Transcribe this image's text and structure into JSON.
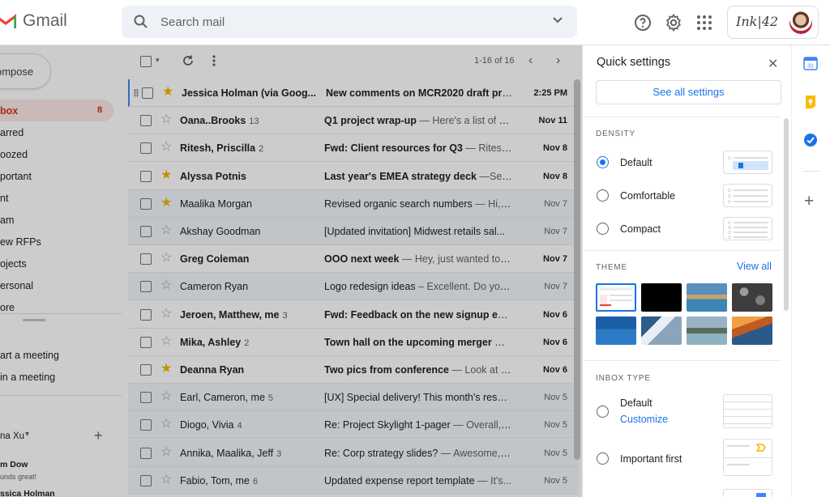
{
  "app": {
    "name": "Gmail"
  },
  "search": {
    "placeholder": "Search mail"
  },
  "account": {
    "brand": "Ink|42"
  },
  "sidebar": {
    "compose": "ompose",
    "items": [
      {
        "label": "box",
        "count": "8",
        "active": true
      },
      {
        "label": "arred"
      },
      {
        "label": "oozed"
      },
      {
        "label": "portant"
      },
      {
        "label": "nt"
      },
      {
        "label": "am"
      },
      {
        "label": "ew RFPs"
      },
      {
        "label": "ojects"
      },
      {
        "label": "ersonal"
      },
      {
        "label": "ore"
      }
    ],
    "meet": [
      "art a meeting",
      "in a meeting"
    ],
    "hangouts_user": "na Xu",
    "chats": [
      {
        "name": "m Dow",
        "sub": "unds great!"
      },
      {
        "name": "ssica Holman"
      }
    ]
  },
  "toolbar": {
    "pagination": "1-16 of 16"
  },
  "emails": [
    {
      "sender": "Jessica Holman (via Goog...",
      "count": "",
      "subject": "New comments on MCR2020 draft pres...",
      "snippet": "",
      "date": "2:25 PM",
      "starred": true,
      "unread": true
    },
    {
      "sender": "Oana..Brooks",
      "count": "13",
      "subject": "Q1 project wrap-up",
      "snippet": " — Here's a list of all...",
      "date": "Nov 11",
      "starred": false,
      "unread": true
    },
    {
      "sender": "Ritesh, Priscilla",
      "count": "2",
      "subject": "Fwd: Client resources for Q3",
      "snippet": " — Ritesh,...",
      "date": "Nov 8",
      "starred": false,
      "unread": true
    },
    {
      "sender": "Alyssa Potnis",
      "count": "",
      "subject": "Last year's EMEA strategy deck",
      "snippet": " —Sendi...",
      "date": "Nov 8",
      "starred": true,
      "unread": true
    },
    {
      "sender": "Maalika Morgan",
      "count": "",
      "subject": "Revised organic search numbers",
      "snippet": " — Hi, a ...",
      "date": "Nov 7",
      "starred": true,
      "unread": false
    },
    {
      "sender": "Akshay Goodman",
      "count": "",
      "subject": "[Updated invitation] Midwest retails sal...",
      "snippet": "",
      "date": "Nov 7",
      "starred": false,
      "unread": false
    },
    {
      "sender": "Greg Coleman",
      "count": "",
      "subject": "OOO next week",
      "snippet": " — Hey, just wanted to g...",
      "date": "Nov 7",
      "starred": false,
      "unread": true
    },
    {
      "sender": "Cameron Ryan",
      "count": "",
      "subject": "Logo redesign ideas",
      "snippet": " – Excellent. Do you...",
      "date": "Nov 7",
      "starred": false,
      "unread": false
    },
    {
      "sender": "Jeroen, Matthew, me",
      "count": "3",
      "subject": "Fwd: Feedback on the new signup expe...",
      "snippet": "",
      "date": "Nov 6",
      "starred": false,
      "unread": true
    },
    {
      "sender": "Mika, Ashley",
      "count": "2",
      "subject": "Town hall on the upcoming merger",
      "snippet": " — Ev...",
      "date": "Nov 6",
      "starred": false,
      "unread": true
    },
    {
      "sender": "Deanna Ryan",
      "count": "",
      "subject": "Two pics from conference",
      "snippet": " — Look at the...",
      "date": "Nov 6",
      "starred": true,
      "unread": true
    },
    {
      "sender": "Earl, Cameron, me",
      "count": "5",
      "subject": "[UX] Special delivery! This month's resea...",
      "snippet": "",
      "date": "Nov 5",
      "starred": false,
      "unread": false
    },
    {
      "sender": "Diogo, Vivia",
      "count": "4",
      "subject": "Re: Project Skylight 1-pager",
      "snippet": " — Overall, it...",
      "date": "Nov 5",
      "starred": false,
      "unread": false
    },
    {
      "sender": "Annika, Maalika, Jeff",
      "count": "3",
      "subject": "Re: Corp strategy slides?",
      "snippet": " — Awesome, th...",
      "date": "Nov 5",
      "starred": false,
      "unread": false
    },
    {
      "sender": "Fabio, Tom, me",
      "count": "6",
      "subject": "Updated expense report template",
      "snippet": " — It's...",
      "date": "Nov 5",
      "starred": false,
      "unread": false
    }
  ],
  "quick_settings": {
    "title": "Quick settings",
    "see_all": "See all settings",
    "density_title": "DENSITY",
    "density": [
      "Default",
      "Comfortable",
      "Compact"
    ],
    "theme_title": "THEME",
    "view_all": "View all",
    "inbox_title": "INBOX TYPE",
    "inbox_default": "Default",
    "customize": "Customize",
    "important_first": "Important first"
  },
  "colors": {
    "accent": "#1a73e8",
    "gmail_red": "#ea4335",
    "star": "#f4b400"
  }
}
